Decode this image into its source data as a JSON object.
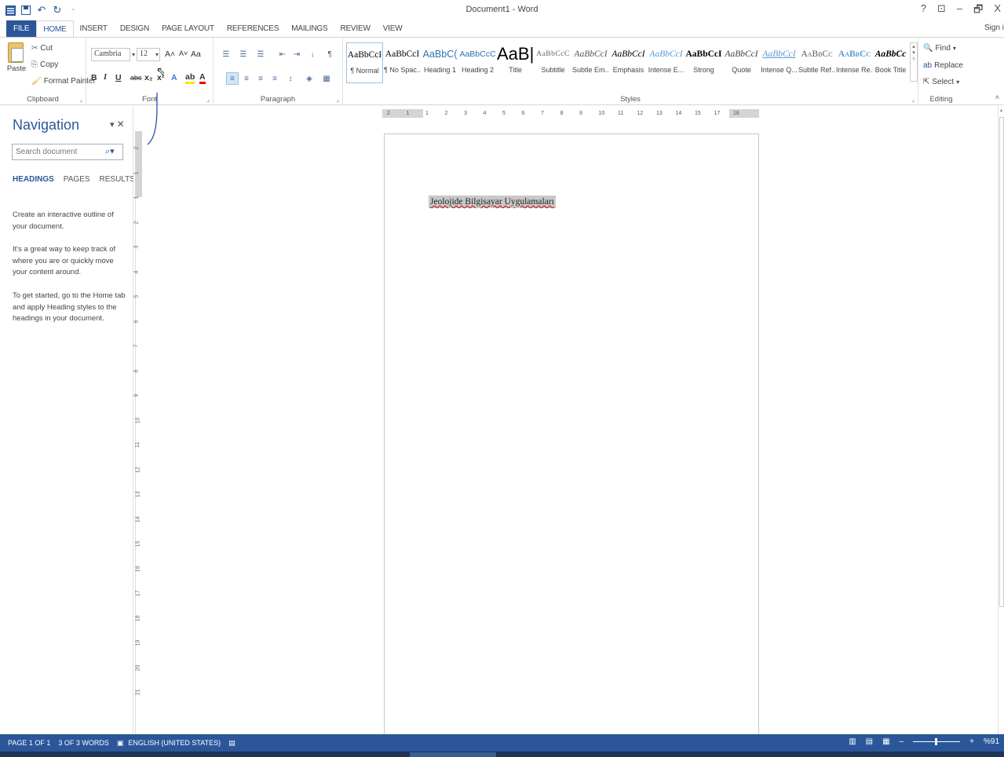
{
  "window": {
    "title": "Document1 - Word",
    "controls": [
      "?",
      "⊡",
      "–",
      "🗗",
      "X"
    ],
    "sign_in": "Sign i"
  },
  "qat": {
    "save_icon": "save-icon",
    "undo_icon": "undo-icon",
    "redo_icon": "redo-icon"
  },
  "tabs": [
    "FILE",
    "HOME",
    "INSERT",
    "DESIGN",
    "PAGE LAYOUT",
    "REFERENCES",
    "MAILINGS",
    "REVIEW",
    "VIEW"
  ],
  "active_tab": "HOME",
  "clipboard": {
    "paste": "Paste",
    "cut": "Cut",
    "copy": "Copy",
    "format_painter": "Format Painter",
    "label": "Clipboard"
  },
  "font": {
    "family": "Cambria",
    "size": "12",
    "label": "Font",
    "buttons": [
      "B",
      "I",
      "U",
      "abc",
      "x₂",
      "x²"
    ],
    "grow": "A˄",
    "shrink": "A˅",
    "case": "Aa"
  },
  "paragraph": {
    "label": "Paragraph"
  },
  "styles": {
    "label": "Styles",
    "items": [
      {
        "preview": "AaBbCcI",
        "name": "¶ Normal"
      },
      {
        "preview": "AaBbCcI",
        "name": "¶ No Spac..."
      },
      {
        "preview": "AaBbC(",
        "name": "Heading 1"
      },
      {
        "preview": "AaBbCcC",
        "name": "Heading 2"
      },
      {
        "preview": "AaB|",
        "name": "Title"
      },
      {
        "preview": "AaBbCcC",
        "name": "Subtitle"
      },
      {
        "preview": "AaBbCcI",
        "name": "Subtle Em..."
      },
      {
        "preview": "AaBbCcI",
        "name": "Emphasis"
      },
      {
        "preview": "AaBbCcI",
        "name": "Intense E..."
      },
      {
        "preview": "AaBbCcI",
        "name": "Strong"
      },
      {
        "preview": "AaBbCcI",
        "name": "Quote"
      },
      {
        "preview": "AaBbCcI",
        "name": "Intense Q..."
      },
      {
        "preview": "AaBbCc",
        "name": "Subtle Ref..."
      },
      {
        "preview": "AaBbCc",
        "name": "Intense Re..."
      },
      {
        "preview": "AaBbCc",
        "name": "Book Title"
      }
    ]
  },
  "editing": {
    "find": "Find",
    "replace": "Replace",
    "select": "Select",
    "label": "Editing"
  },
  "navigation": {
    "title": "Navigation",
    "search_placeholder": "Search document",
    "tabs": [
      "HEADINGS",
      "PAGES",
      "RESULTS"
    ],
    "active_tab": "HEADINGS",
    "messages": [
      "Create an interactive outline of your document.",
      "It's a great way to keep track of where you are or quickly move your content around.",
      "To get started, go to the Home tab and apply Heading styles to the headings in your document."
    ]
  },
  "ruler": {
    "h_numbers": [
      "2",
      "1",
      "1",
      "2",
      "3",
      "4",
      "5",
      "6",
      "7",
      "8",
      "9",
      "10",
      "11",
      "12",
      "13",
      "14",
      "15",
      "17",
      "18"
    ],
    "v_numbers": [
      "2",
      "1",
      "1",
      "2",
      "3",
      "4",
      "5",
      "6",
      "7",
      "8",
      "9",
      "10",
      "11",
      "12",
      "13",
      "14",
      "15",
      "16",
      "17",
      "18",
      "19",
      "20",
      "21"
    ],
    "tab_selector": "L"
  },
  "document": {
    "text": "Jeolojide Bilgisayar Uygulamaları"
  },
  "status": {
    "page": "PAGE 1 OF 1",
    "words": "3 OF 3 WORDS",
    "language": "ENGLISH (UNITED STATES)",
    "zoom": "%91"
  },
  "colors": {
    "accent": "#2b579a",
    "selection": "#c8c8c8"
  }
}
